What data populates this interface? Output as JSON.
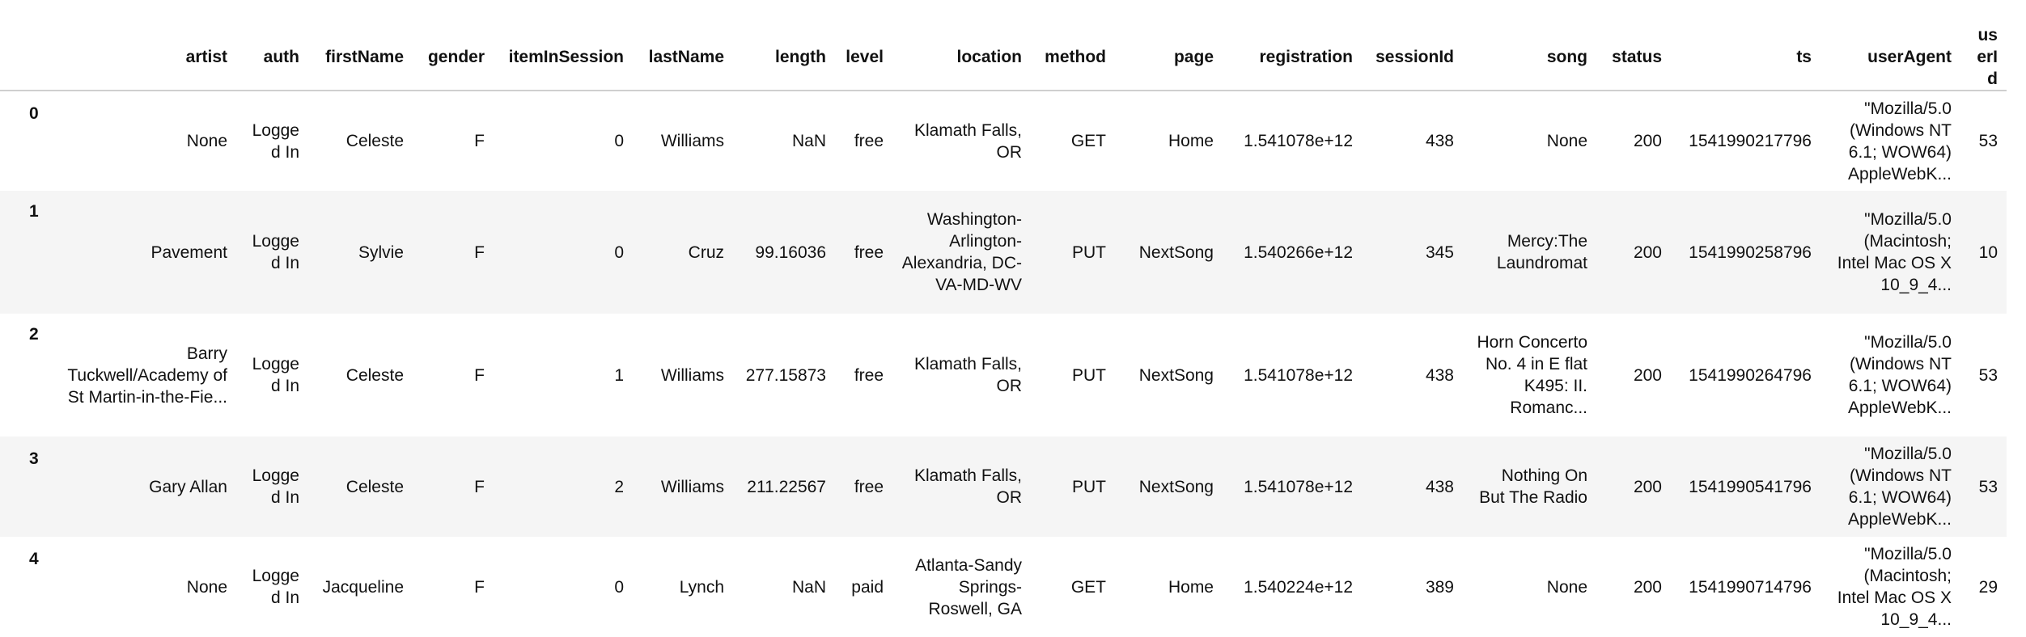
{
  "table": {
    "columns": [
      "artist",
      "auth",
      "firstName",
      "gender",
      "itemInSession",
      "lastName",
      "length",
      "level",
      "location",
      "method",
      "page",
      "registration",
      "sessionId",
      "song",
      "status",
      "ts",
      "userAgent",
      "userId"
    ],
    "rows": [
      {
        "index": "0",
        "cells": [
          "None",
          "Logged In",
          "Celeste",
          "F",
          "0",
          "Williams",
          "NaN",
          "free",
          "Klamath Falls, OR",
          "GET",
          "Home",
          "1.541078e+12",
          "438",
          "None",
          "200",
          "1541990217796",
          "\"Mozilla/5.0 (Windows NT 6.1; WOW64) AppleWebK...",
          "53"
        ]
      },
      {
        "index": "1",
        "cells": [
          "Pavement",
          "Logged In",
          "Sylvie",
          "F",
          "0",
          "Cruz",
          "99.16036",
          "free",
          "Washington-Arlington-Alexandria, DC-VA-MD-WV",
          "PUT",
          "NextSong",
          "1.540266e+12",
          "345",
          "Mercy:The Laundromat",
          "200",
          "1541990258796",
          "\"Mozilla/5.0 (Macintosh; Intel Mac OS X 10_9_4...",
          "10"
        ]
      },
      {
        "index": "2",
        "cells": [
          "Barry Tuckwell/Academy of St Martin-in-the-Fie...",
          "Logged In",
          "Celeste",
          "F",
          "1",
          "Williams",
          "277.15873",
          "free",
          "Klamath Falls, OR",
          "PUT",
          "NextSong",
          "1.541078e+12",
          "438",
          "Horn Concerto No. 4 in E flat K495: II. Romanc...",
          "200",
          "1541990264796",
          "\"Mozilla/5.0 (Windows NT 6.1; WOW64) AppleWebK...",
          "53"
        ]
      },
      {
        "index": "3",
        "cells": [
          "Gary Allan",
          "Logged In",
          "Celeste",
          "F",
          "2",
          "Williams",
          "211.22567",
          "free",
          "Klamath Falls, OR",
          "PUT",
          "NextSong",
          "1.541078e+12",
          "438",
          "Nothing On But The Radio",
          "200",
          "1541990541796",
          "\"Mozilla/5.0 (Windows NT 6.1; WOW64) AppleWebK...",
          "53"
        ]
      },
      {
        "index": "4",
        "cells": [
          "None",
          "Logged In",
          "Jacqueline",
          "F",
          "0",
          "Lynch",
          "NaN",
          "paid",
          "Atlanta-Sandy Springs-Roswell, GA",
          "GET",
          "Home",
          "1.540224e+12",
          "389",
          "None",
          "200",
          "1541990714796",
          "\"Mozilla/5.0 (Macintosh; Intel Mac OS X 10_9_4...",
          "29"
        ]
      }
    ]
  }
}
